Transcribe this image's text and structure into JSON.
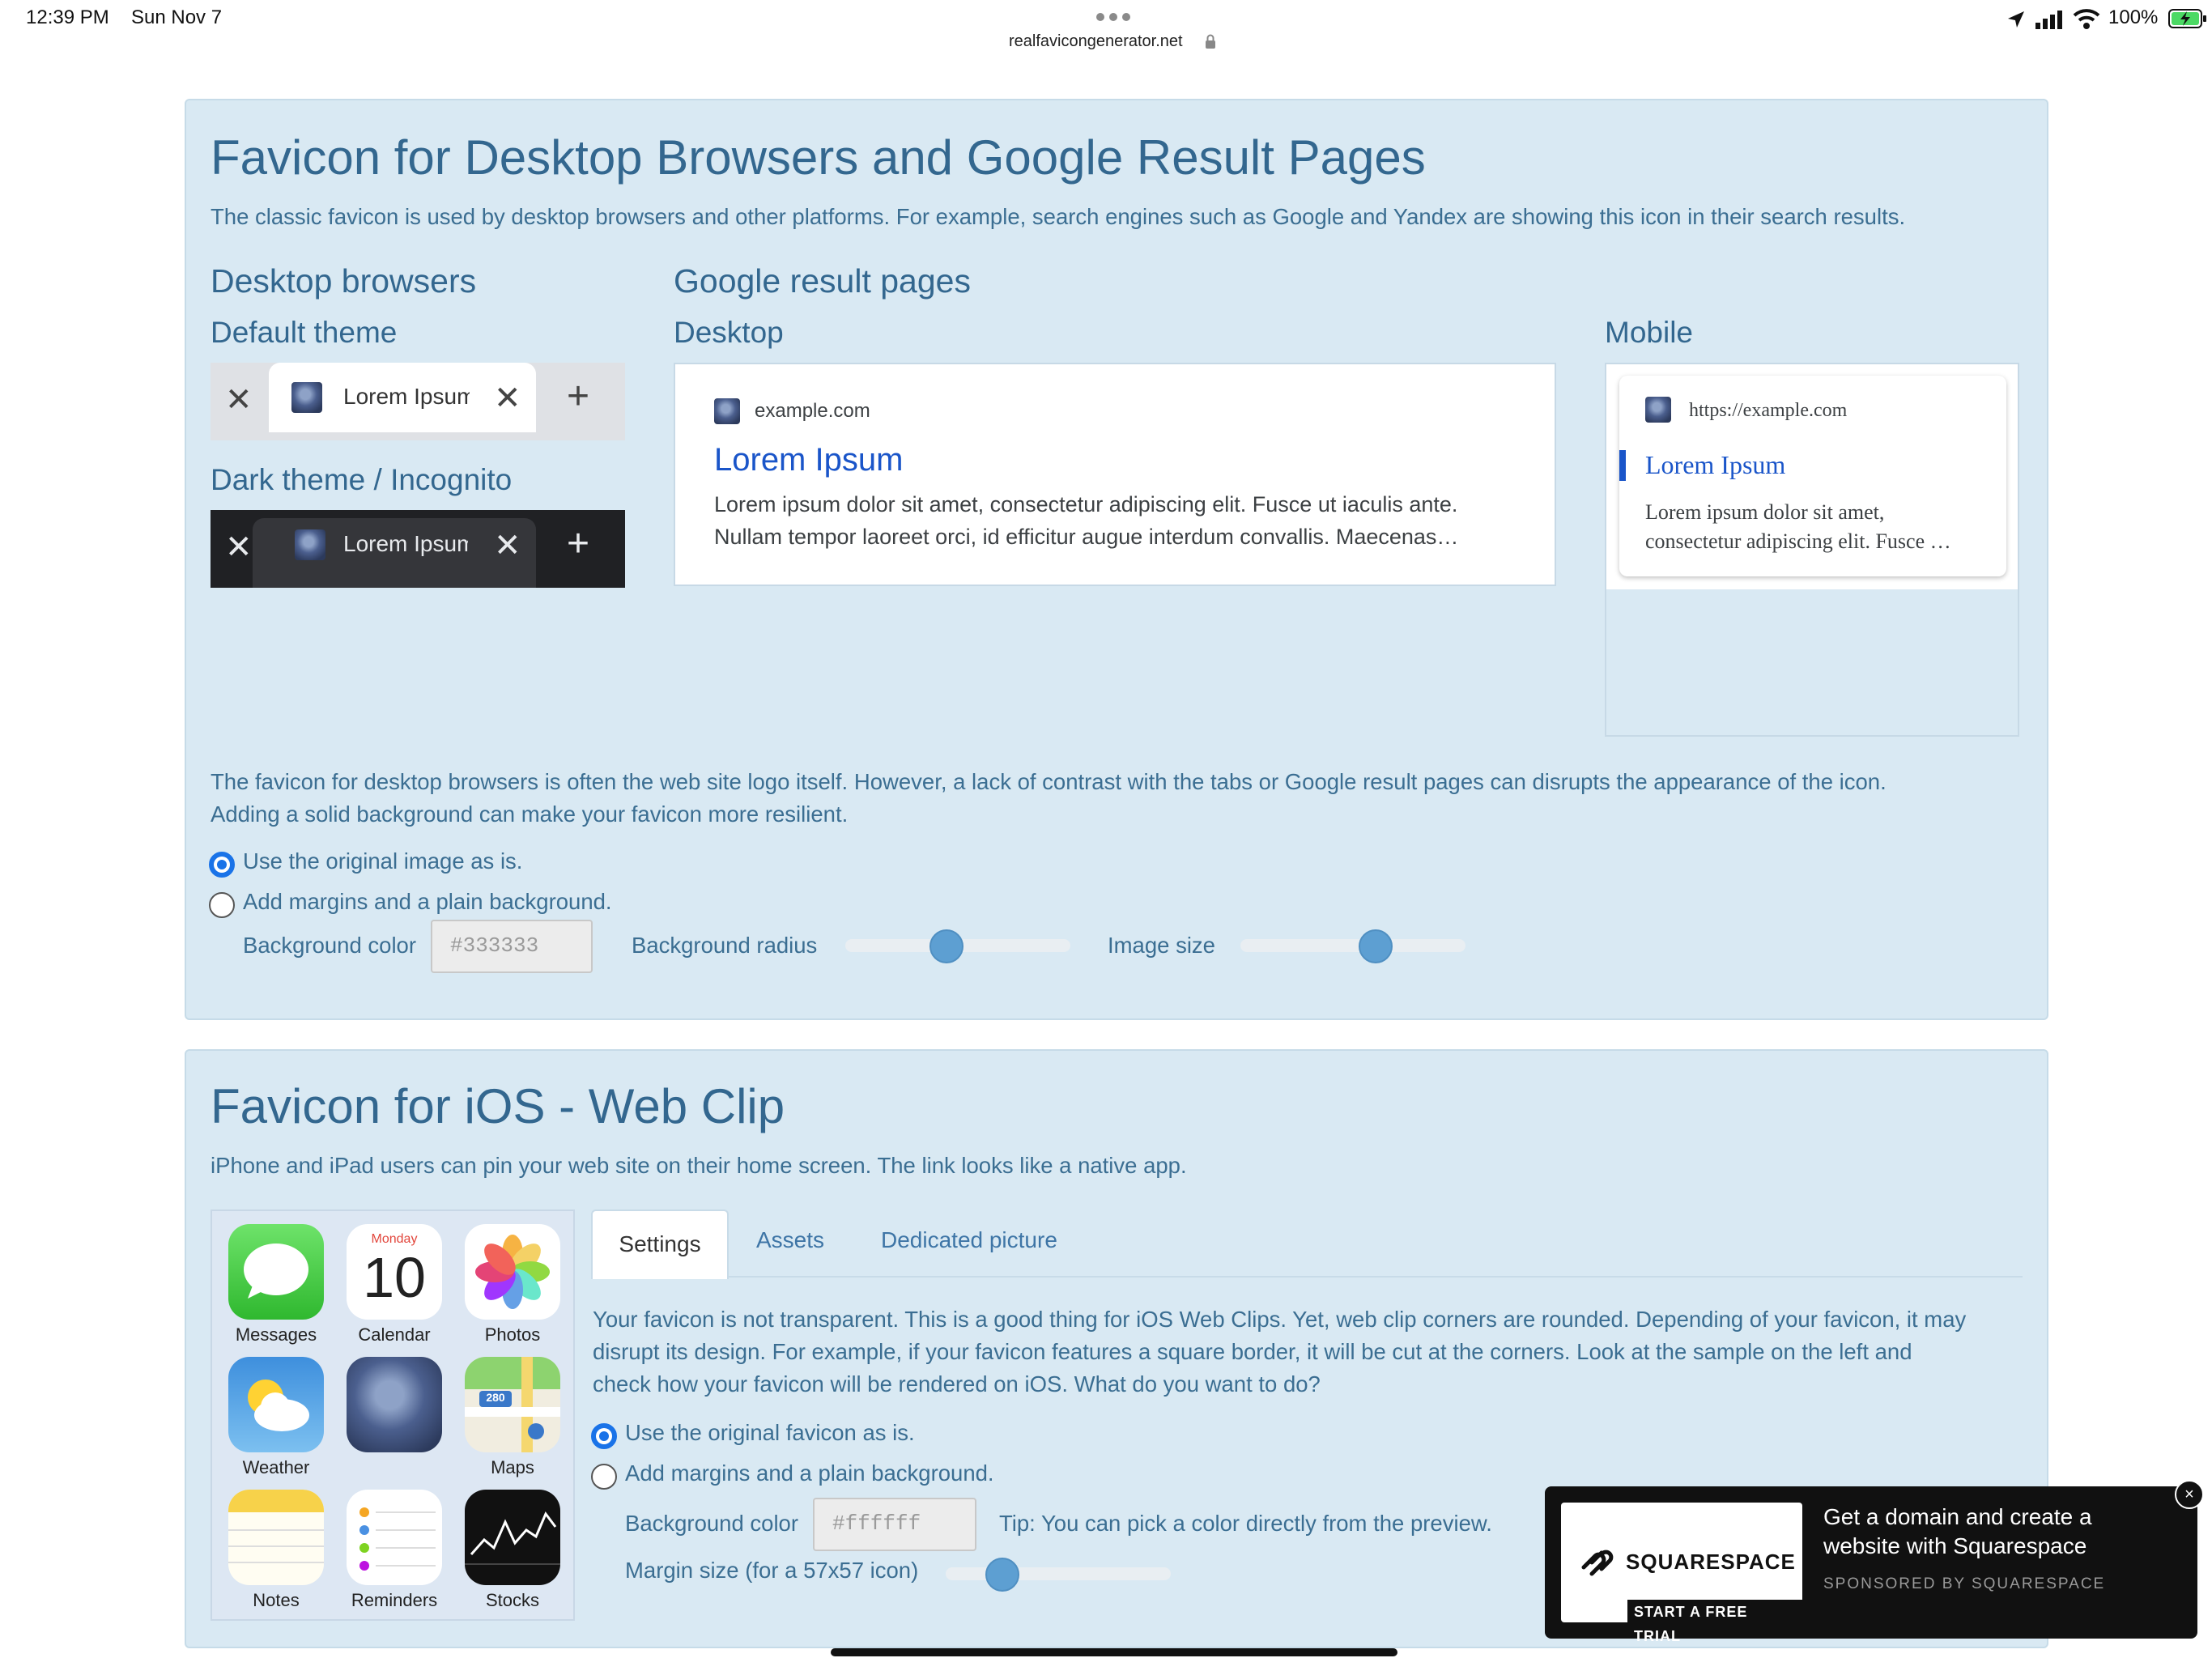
{
  "status_bar": {
    "time": "12:39 PM",
    "date": "Sun Nov 7",
    "url": "realfavicongenerator.net",
    "battery": "100%"
  },
  "desktop_section": {
    "title": "Favicon for Desktop Browsers and Google Result Pages",
    "description": "The classic favicon is used by desktop browsers and other platforms. For example, search engines such as Google and Yandex are showing this icon in their search results.",
    "desktop_browsers_heading": "Desktop browsers",
    "default_theme_label": "Default theme",
    "dark_theme_label": "Dark theme / Incognito",
    "tab_text": "Lorem Ipsum",
    "google_heading": "Google result pages",
    "google_desktop_label": "Desktop",
    "google_mobile_label": "Mobile",
    "desktop_result": {
      "domain": "example.com",
      "title": "Lorem Ipsum",
      "snippet_line1": "Lorem ipsum dolor sit amet, consectetur adipiscing elit. Fusce ut iaculis ante.",
      "snippet_line2": "Nullam tempor laoreet orci, id efficitur augue interdum convallis. Maecenas…"
    },
    "mobile_result": {
      "url": "https://example.com",
      "title": "Lorem Ipsum",
      "snippet_line1": "Lorem ipsum dolor sit amet,",
      "snippet_line2": "consectetur adipiscing elit. Fusce …"
    },
    "note_line1": "The favicon for desktop browsers is often the web site logo itself. However, a lack of contrast with the tabs or Google result pages can disrupts the appearance of the icon.",
    "note_line2": "Adding a solid background can make your favicon more resilient.",
    "option_original": "Use the original image as is.",
    "option_margins": "Add margins and a plain background.",
    "bg_color_label": "Background color",
    "bg_color_placeholder": "#333333",
    "bg_radius_label": "Background radius",
    "image_size_label": "Image size",
    "bg_radius_value": 0.45,
    "image_size_value": 0.6
  },
  "ios_section": {
    "title": "Favicon for iOS - Web Clip",
    "description": "iPhone and iPad users can pin your web site on their home screen. The link looks like a native app.",
    "apps": [
      {
        "label": "Messages"
      },
      {
        "label": "Calendar",
        "weekday": "Monday",
        "day": "10"
      },
      {
        "label": "Photos"
      },
      {
        "label": "Weather"
      },
      {
        "label": ""
      },
      {
        "label": "Maps",
        "badge": "280"
      },
      {
        "label": "Notes"
      },
      {
        "label": "Reminders"
      },
      {
        "label": "Stocks"
      }
    ],
    "tabs": [
      "Settings",
      "Assets",
      "Dedicated picture"
    ],
    "info_line1": "Your favicon is not transparent. This is a good thing for iOS Web Clips. Yet, web clip corners are rounded. Depending of your favicon, it may",
    "info_line2": "disrupt its design. For example, if your favicon features a square border, it will be cut at the corners. Look at the sample on the left and",
    "info_line3": "check how your favicon will be rendered on iOS. What do you want to do?",
    "option_original": "Use the original favicon as is.",
    "option_margins": "Add margins and a plain background.",
    "bg_color_label": "Background color",
    "bg_color_placeholder": "#ffffff",
    "tip": "Tip: You can pick a color directly from the preview.",
    "margin_label": "Margin size (for a 57x57 icon)",
    "margin_value": 0.25
  },
  "ad": {
    "brand": "SQUARESPACE",
    "cta": "START A FREE TRIAL",
    "headline_line1": "Get a domain and create a",
    "headline_line2": "website with Squarespace",
    "sponsor": "SPONSORED BY SQUARESPACE"
  }
}
